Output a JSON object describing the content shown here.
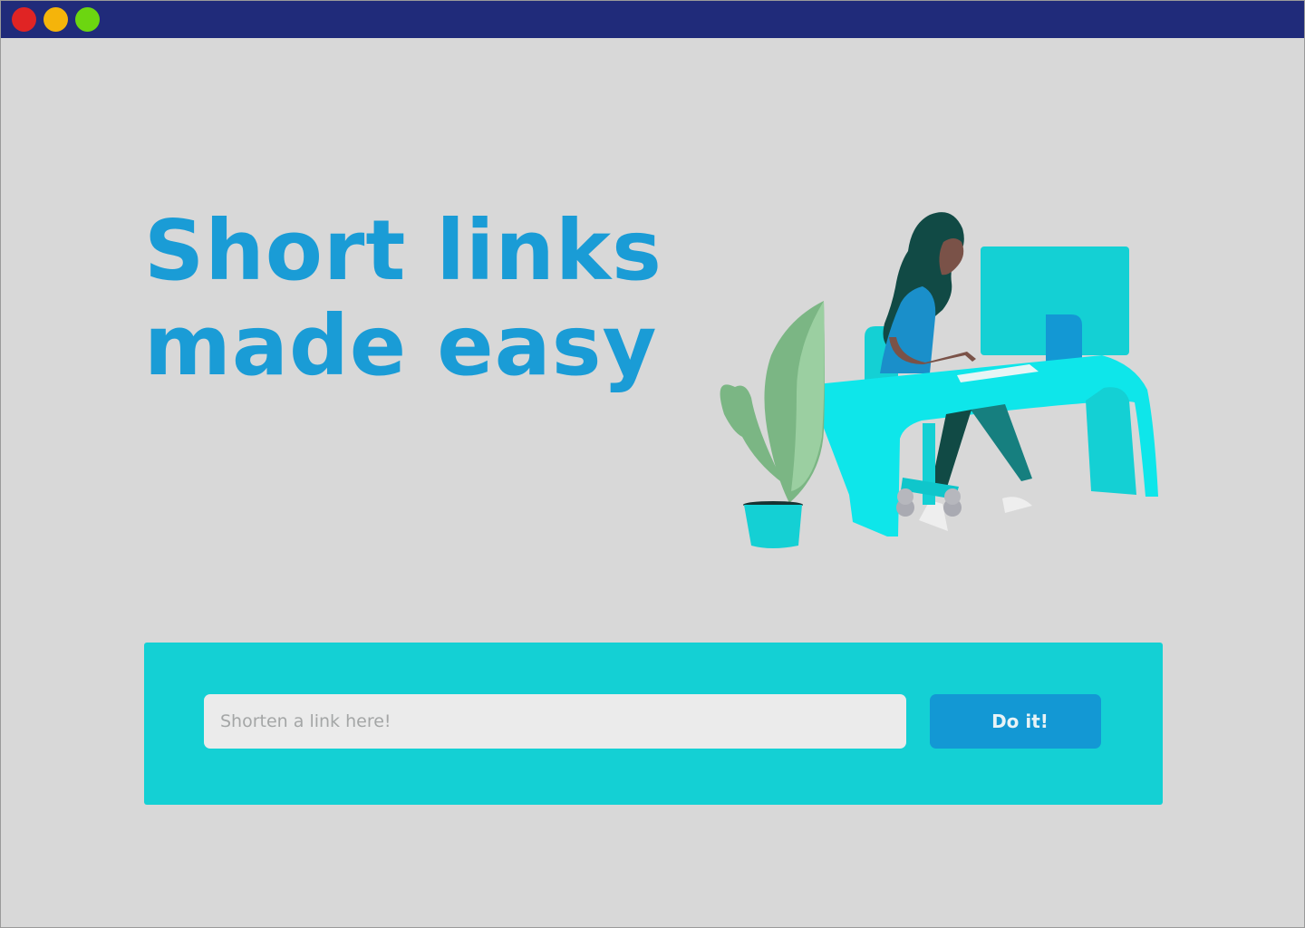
{
  "window": {
    "controls": [
      {
        "name": "close",
        "color": "#e02424"
      },
      {
        "name": "minimize",
        "color": "#f5b40a"
      },
      {
        "name": "maximize",
        "color": "#6cd610"
      }
    ],
    "titlebar_color": "#202b7a",
    "background_color": "#d8d8d8"
  },
  "hero": {
    "headline_line1": "Short links",
    "headline_line2": "made easy",
    "headline_color": "#1a9cd6",
    "illustration": "person-working-at-desk-with-plant"
  },
  "shortener": {
    "panel_color": "#14d0d4",
    "input_placeholder": "Shorten a link here!",
    "input_value": "",
    "input_background": "#ebebeb",
    "button_label": "Do it!",
    "button_color": "#1398d4"
  },
  "colors": {
    "accent_cyan": "#0ee6ea",
    "accent_blue": "#1398d4"
  }
}
